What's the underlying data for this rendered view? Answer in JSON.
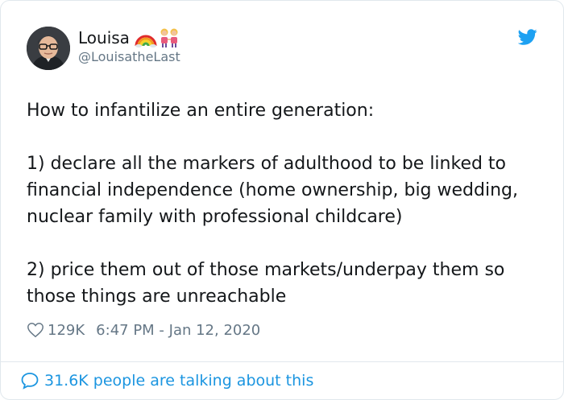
{
  "user": {
    "name": "Louisa",
    "handle": "@LouisatheLast",
    "name_emojis": [
      "rainbow-icon",
      "two-women-icon"
    ]
  },
  "tweet": {
    "intro": "How to infantilize an entire generation:",
    "point_1": "1) declare all the markers of adulthood to be linked to financial independence (home ownership, big wedding, nuclear family with professional childcare)",
    "point_2": "2) price them out of those markets/underpay them so those things are unreachable"
  },
  "meta": {
    "likes": "129K",
    "timestamp": "6:47 PM - Jan 12, 2020"
  },
  "footer": {
    "talking_text": "31.6K people are talking about this"
  },
  "colors": {
    "accent": "#1b95e0",
    "text": "#14171a",
    "secondary": "#657786",
    "border": "#e1e8ed"
  }
}
